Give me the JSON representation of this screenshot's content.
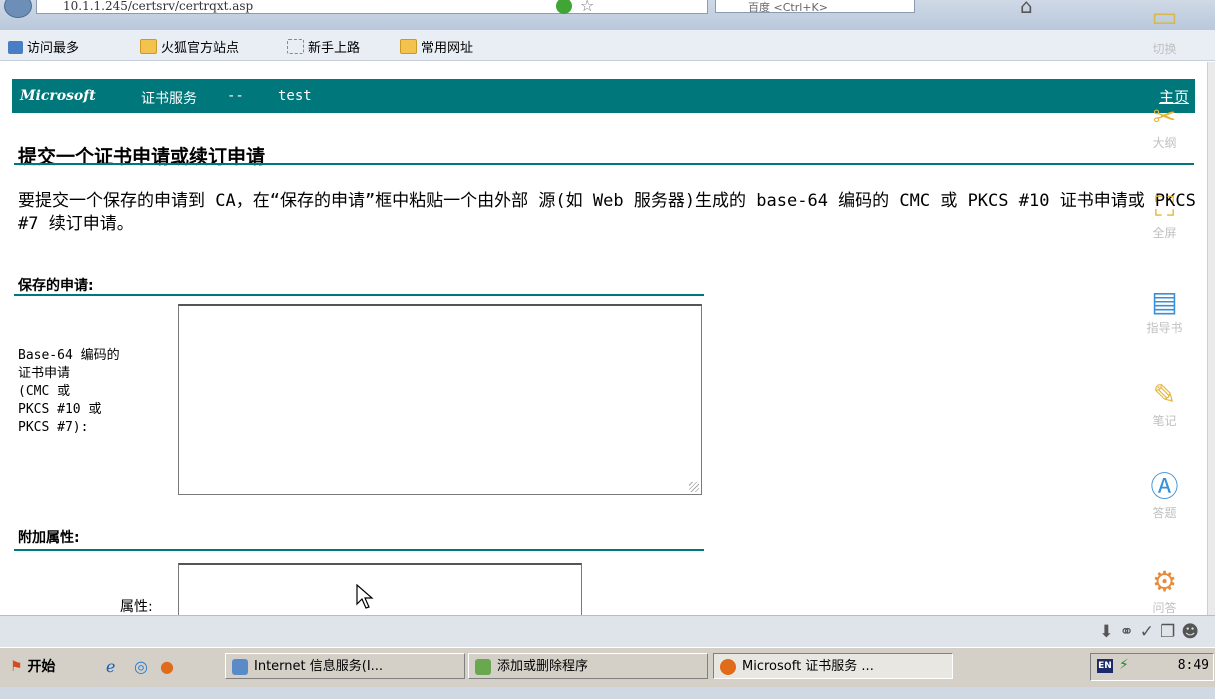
{
  "browser": {
    "url": "10.1.1.245/certsrv/certrqxt.asp",
    "search_placeholder": "百度 <Ctrl+K>",
    "bookmarks": [
      "访问最多",
      "火狐官方站点",
      "新手上路",
      "常用网址"
    ]
  },
  "page": {
    "header": {
      "brand": "Microsoft",
      "service": "证书服务",
      "separator": "--",
      "ca_name": "test",
      "home_link": "主页"
    },
    "title": "提交一个证书申请或续订申请",
    "intro": "要提交一个保存的申请到 CA，在“保存的申请”框中粘贴一个由外部 源(如 Web 服务器)生成的 base-64 编码的 CMC 或 PKCS #10 证书申请或 PKCS #7 续订申请。",
    "saved_request": {
      "heading": "保存的申请:",
      "label_lines": [
        "Base-64 编码的",
        "证书申请",
        "(CMC 或",
        "PKCS #10 或",
        "PKCS #7):"
      ],
      "value": ""
    },
    "additional": {
      "heading": "附加属性:",
      "attr_label": "属性:",
      "value": ""
    }
  },
  "tools": [
    "切换",
    "大纲",
    "全屏",
    "指导书",
    "笔记",
    "答题",
    "问答"
  ],
  "taskbar": {
    "start": "开始",
    "buttons": [
      "Internet 信息服务(I...",
      "添加或删除程序",
      "Microsoft 证书服务 ..."
    ],
    "lang": "EN",
    "clock": "8:49"
  }
}
